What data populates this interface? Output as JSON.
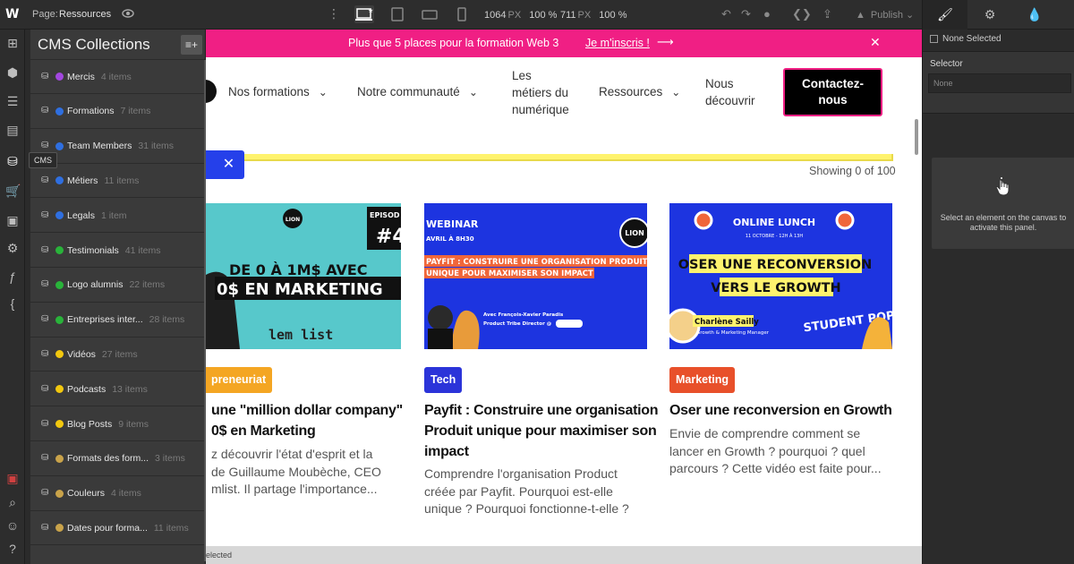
{
  "topbar": {
    "logo": "W",
    "page_label": "Page:",
    "page_value": "Ressources",
    "width_value": "1064",
    "width_unit": "PX",
    "width_pct": "100 %",
    "height_value": "711",
    "height_unit": "PX",
    "height_pct": "100 %",
    "publish_label": "Publish"
  },
  "right_panel": {
    "none_selected": "None Selected",
    "selector_label": "Selector",
    "selector_placeholder": "None",
    "hint": "Select an element on the canvas to activate this panel."
  },
  "iconbar": {
    "tooltip": "CMS"
  },
  "cms": {
    "title": "CMS Collections",
    "items": [
      {
        "name": "Mercis",
        "count": "4 items",
        "dot_color": "#a347e0"
      },
      {
        "name": "Formations",
        "count": "7 items",
        "dot_color": "#2f6fe0"
      },
      {
        "name": "Team Members",
        "count": "31 items",
        "dot_color": "#2f6fe0"
      },
      {
        "name": "Métiers",
        "count": "11 items",
        "dot_color": "#2f6fe0"
      },
      {
        "name": "Legals",
        "count": "1 item",
        "dot_color": "#2f6fe0"
      },
      {
        "name": "Testimonials",
        "count": "41 items",
        "dot_color": "#29b33a"
      },
      {
        "name": "Logo alumnis",
        "count": "22 items",
        "dot_color": "#29b33a"
      },
      {
        "name": "Entreprises inter...",
        "count": "28 items",
        "dot_color": "#29b33a"
      },
      {
        "name": "Vidéos",
        "count": "27 items",
        "dot_color": "#f2c80f"
      },
      {
        "name": "Podcasts",
        "count": "13 items",
        "dot_color": "#f2c80f"
      },
      {
        "name": "Blog Posts",
        "count": "9 items",
        "dot_color": "#f2c80f"
      },
      {
        "name": "Formats des form...",
        "count": "3 items",
        "dot_color": "#c9a34a"
      },
      {
        "name": "Couleurs",
        "count": "4 items",
        "dot_color": "#c9a34a"
      },
      {
        "name": "Dates pour forma...",
        "count": "11 items",
        "dot_color": "#c9a34a"
      }
    ]
  },
  "banner": {
    "message": "Plus que 5 places pour la formation Web 3",
    "cta": "Je m'inscris !"
  },
  "nav": {
    "formations": "Nos formations",
    "communaute": "Notre communauté",
    "metiers_1": "Les",
    "metiers_2": "métiers du",
    "metiers_3": "numérique",
    "ressources": "Ressources",
    "decouvrir_1": "Nous",
    "decouvrir_2": "découvrir",
    "contact_1": "Contactez-",
    "contact_2": "nous"
  },
  "listing": {
    "showing": "Showing 0 of 100"
  },
  "cards": [
    {
      "tag": "preneuriat",
      "tag_color": "#f4a623",
      "title_1": "une \"million dollar company\"",
      "title_2": "0$ en Marketing",
      "desc_1": "z découvrir l'état d'esprit et la",
      "desc_2": "de Guillaume Moubèche, CEO",
      "desc_3": "mlist. Il partage l'importance...",
      "img_logo": "LION",
      "img_episode": "EPISOD",
      "img_number": "#4",
      "img_line1": "DE 0 À 1M$ AVEC",
      "img_line2": "0$ EN MARKETING",
      "img_brand": "lem list"
    },
    {
      "tag": "Tech",
      "tag_color": "#2b34d9",
      "title_1": "Payfit : Construire une organisation",
      "title_2": "Produit unique pour maximiser son",
      "title_3": "impact",
      "desc_1": "Comprendre l'organisation Product",
      "desc_2": "créée par Payfit. Pourquoi est-elle",
      "desc_3": "unique ? Pourquoi fonctionne-t-elle ?",
      "img_webinar": "WEBINAR",
      "img_date": "AVRIL À 8H30",
      "img_line1": "PAYFIT : CONSTRUIRE UNE ORGANISATION PRODUIT",
      "img_line2": "UNIQUE POUR MAXIMISER SON IMPACT",
      "img_speaker": "Avec François-Xavier Paradis",
      "img_role": "Product Tribe Director @",
      "img_logo": "LION"
    },
    {
      "tag": "Marketing",
      "tag_color": "#e8502a",
      "title_1": "Oser une reconversion en Growth",
      "desc_1": "Envie de comprendre comment se",
      "desc_2": "lancer en Growth ? pourquoi ? quel",
      "desc_3": "parcours ? Cette vidéo est faite pour...",
      "img_head": "ONLINE LUNCH",
      "img_date": "11 OCTOBRE - 12H À 13H",
      "img_line1": "OSER UNE RECONVERSION",
      "img_line2": "VERS LE GROWTH",
      "img_speaker": "Charlène Sailly",
      "img_role": "Growth & Marketing Manager",
      "img_brand": "STUDENT POP"
    }
  ],
  "status": {
    "text": "elected"
  }
}
